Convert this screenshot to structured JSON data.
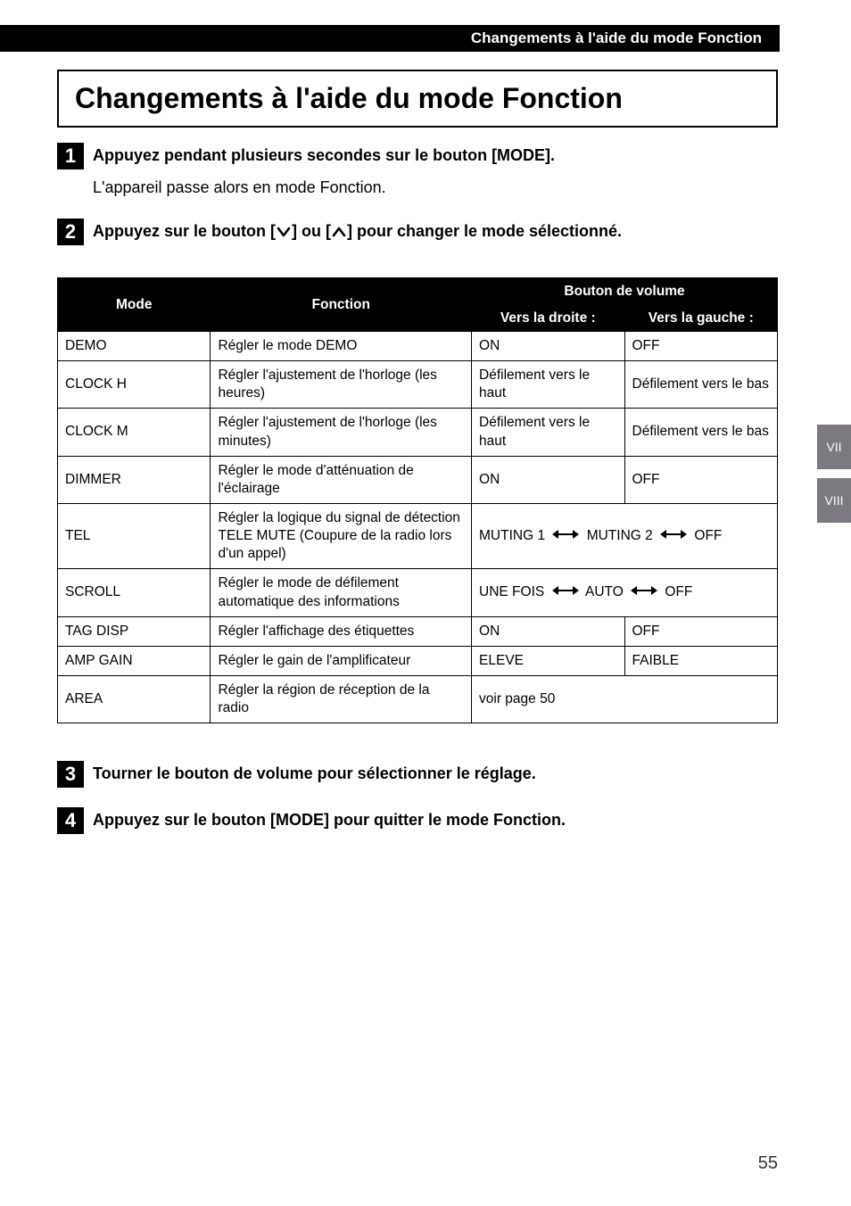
{
  "header": {
    "breadcrumb": "Changements à l'aide du mode Fonction"
  },
  "title": "Changements à l'aide du mode Fonction",
  "steps": {
    "s1": {
      "num": "1",
      "title": "Appuyez pendant plusieurs secondes sur le bouton [MODE].",
      "body": "L'appareil passe alors en mode Fonction."
    },
    "s2": {
      "num": "2",
      "title_pre": "Appuyez sur le bouton [",
      "title_mid": "] ou [",
      "title_post": "] pour changer le mode sélectionné."
    },
    "s3": {
      "num": "3",
      "title": "Tourner le bouton de volume pour sélectionner le réglage."
    },
    "s4": {
      "num": "4",
      "title": "Appuyez sur le bouton [MODE] pour quitter le mode Fonction."
    }
  },
  "table": {
    "headers": {
      "mode": "Mode",
      "fn": "Fonction",
      "vol": "Bouton de volume",
      "right": "Vers la droite :",
      "left": "Vers la gauche :"
    },
    "rows": [
      {
        "mode": "DEMO",
        "fn": "Régler le mode DEMO",
        "right": "ON",
        "left": "OFF"
      },
      {
        "mode": "CLOCK H",
        "fn": "Régler l'ajustement de l'horloge (les heures)",
        "right": "Défilement vers le haut",
        "left": "Défilement vers le bas"
      },
      {
        "mode": "CLOCK M",
        "fn": "Régler l'ajustement de l'horloge (les minutes)",
        "right": "Défilement vers le haut",
        "left": "Défilement vers le bas"
      },
      {
        "mode": "DIMMER",
        "fn": "Régler le mode d'atténuation de l'éclairage",
        "right": "ON",
        "left": "OFF"
      },
      {
        "mode": "TEL",
        "fn": "Régler la logique du signal de détection TELE MUTE (Coupure de la radio lors d'un appel)",
        "seq": [
          "MUTING 1",
          "MUTING 2",
          "OFF"
        ]
      },
      {
        "mode": "SCROLL",
        "fn": "Régler le mode de défilement automatique des informations",
        "seq": [
          "UNE FOIS",
          "AUTO",
          "OFF"
        ]
      },
      {
        "mode": "TAG DISP",
        "fn": "Régler l'affichage des étiquettes",
        "right": "ON",
        "left": "OFF"
      },
      {
        "mode": "AMP GAIN",
        "fn": "Régler le gain de l'amplificateur",
        "right": "ELEVE",
        "left": "FAIBLE"
      },
      {
        "mode": "AREA",
        "fn": "Régler la région de réception de la radio",
        "merged": "voir page 50"
      }
    ]
  },
  "tabs": {
    "vii": "VII",
    "viii": "VIII"
  },
  "page_number": "55"
}
